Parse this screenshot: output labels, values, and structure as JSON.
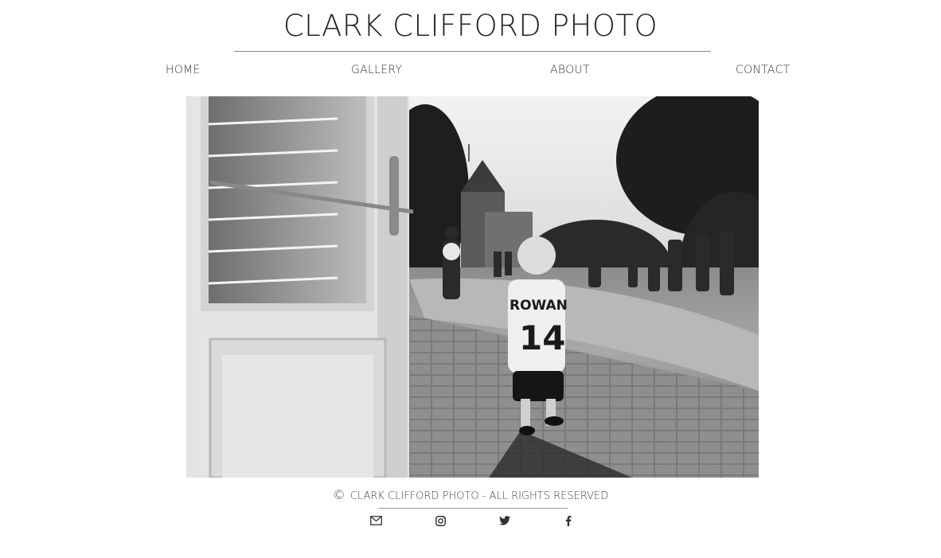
{
  "site": {
    "title": "CLARK CLIFFORD PHOTO"
  },
  "nav": {
    "items": [
      {
        "label": "HOME"
      },
      {
        "label": "GALLERY"
      },
      {
        "label": "ABOUT"
      },
      {
        "label": "CONTACT"
      }
    ]
  },
  "photo": {
    "jersey_name": "ROWAN",
    "jersey_number": "14"
  },
  "footer": {
    "copyright_symbol": "©",
    "copyright_text": "CLARK CLIFFORD PHOTO - ALL RIGHTS RESERVED",
    "social_icons": [
      "email-icon",
      "instagram-icon",
      "twitter-icon",
      "facebook-icon"
    ]
  },
  "colors": {
    "text": "#333333",
    "rule": "#8a8a8a",
    "background": "#ffffff"
  }
}
